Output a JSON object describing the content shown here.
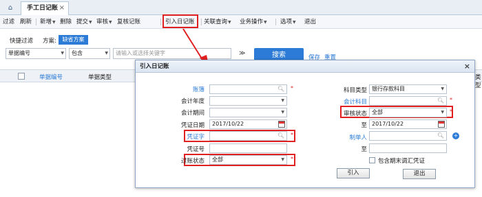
{
  "tabs": {
    "home_icon": "home-icon",
    "active_tab": "手工日记账",
    "close_glyph": "×"
  },
  "toolbar": {
    "items": [
      "过滤",
      "刷新",
      "新增",
      "删除",
      "提交",
      "审核",
      "复核记账",
      "引入日记账",
      "关联查询",
      "业务操作",
      "选项",
      "退出"
    ]
  },
  "quick_filter": {
    "label": "快捷过滤",
    "scheme_label": "方案:",
    "scheme_button": "缺省方案",
    "field": "单据编号",
    "operator": "包含",
    "placeholder": "请输入或选择关键字",
    "search_button": "搜索",
    "save_link": "保存",
    "reset_link": "重置"
  },
  "grid": {
    "col1": "单据编号",
    "col2": "单据类型",
    "col_right": "类型"
  },
  "dialog": {
    "title": "引入日记账",
    "close": "×",
    "left": {
      "account_book": "账簿",
      "fiscal_year": "会计年度",
      "fiscal_period": "会计期间",
      "voucher_date": "凭证日期",
      "voucher_date_value": "2017/10/22",
      "voucher_word": "凭证字",
      "voucher_no": "凭证号",
      "posting_status": "过账状态",
      "posting_status_value": "全部"
    },
    "right": {
      "account_type": "科目类型",
      "account_type_value": "银行存款科目",
      "account": "会计科目",
      "audit_status": "审核状态",
      "audit_status_value": "全部",
      "to": "至",
      "to_date_value": "2017/10/22",
      "creator": "制单人",
      "to2": "至",
      "include_closing": "包含期末调汇凭证"
    },
    "import_button": "引入",
    "exit_button": "退出"
  }
}
